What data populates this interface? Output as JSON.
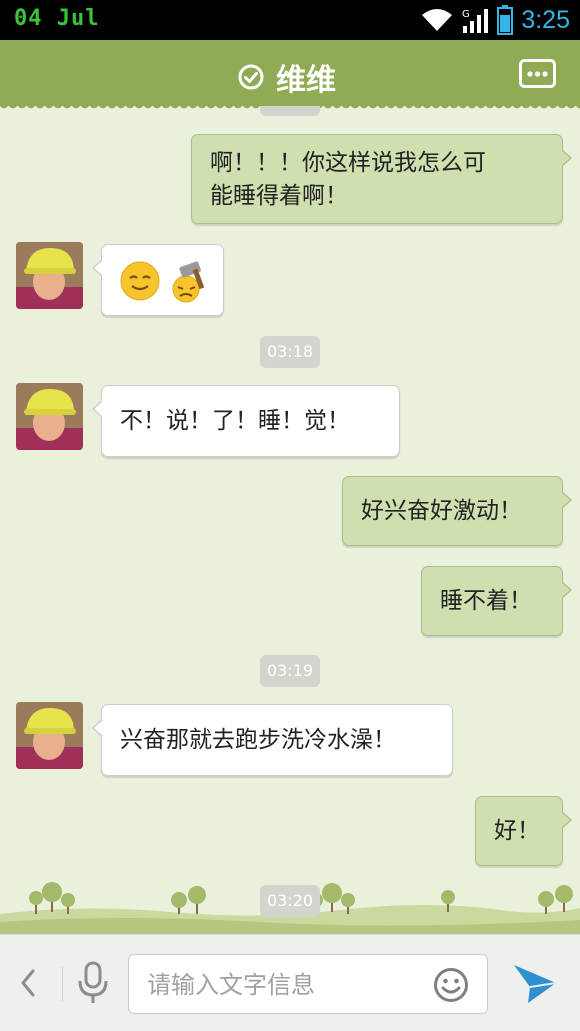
{
  "status_bar": {
    "date": "04  Jul",
    "time": "3:25",
    "icons": [
      "wifi-icon",
      "signal-icon",
      "battery-icon"
    ]
  },
  "header": {
    "title": "维维",
    "status_icon": "check-circle-icon",
    "menu_icon": "more-icon"
  },
  "messages": [
    {
      "type": "out",
      "lines": [
        "啊！！！你这样说我怎么可",
        "能睡得着啊！"
      ]
    },
    {
      "type": "in",
      "stickers": [
        "smile-emoji-icon",
        "hammer-emoji-icon"
      ]
    },
    {
      "type": "timestamp",
      "text": "03:18"
    },
    {
      "type": "in",
      "lines": [
        "不！说！了！睡！觉！"
      ]
    },
    {
      "type": "out",
      "lines": [
        "好兴奋好激动！"
      ]
    },
    {
      "type": "out",
      "lines": [
        "睡不着！"
      ]
    },
    {
      "type": "timestamp",
      "text": "03:19"
    },
    {
      "type": "in",
      "lines": [
        "兴奋那就去跑步洗冷水澡！"
      ]
    },
    {
      "type": "out",
      "lines": [
        "好！"
      ]
    },
    {
      "type": "timestamp",
      "text": "03:20"
    }
  ],
  "input_bar": {
    "placeholder": "请输入文字信息",
    "icons": [
      "back-chevron-icon",
      "microphone-icon",
      "emoji-icon",
      "send-icon"
    ]
  },
  "colors": {
    "header_green": "#8fac54",
    "chat_bg": "#e9f0dc",
    "out_bubble": "#cfdfb0",
    "in_bubble": "#ffffff",
    "time_blue": "#33b5e5"
  }
}
